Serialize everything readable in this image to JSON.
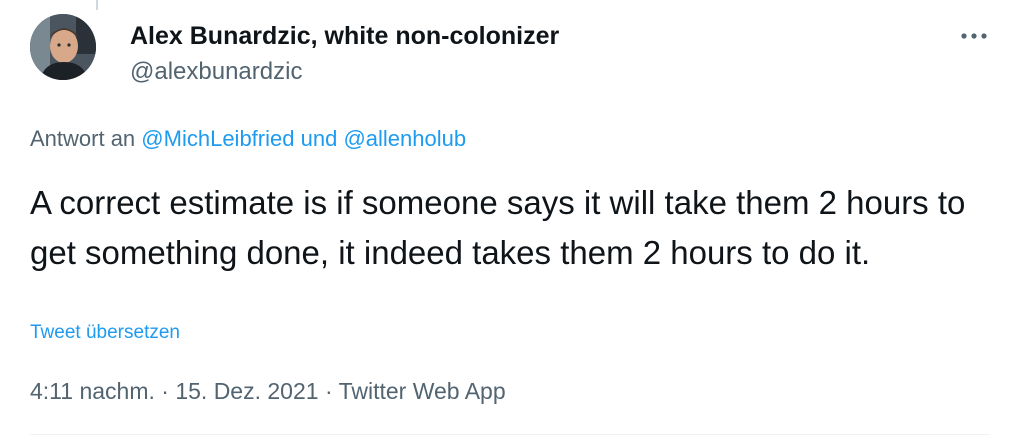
{
  "author": {
    "name": "Alex Bunardzic, white non-colonizer",
    "handle": "@alexbunardzic"
  },
  "reply": {
    "prefix": "Antwort an",
    "mention_1": "@MichLeibfried",
    "conjunction": "und",
    "mention_2": "@allenholub"
  },
  "tweet": {
    "text": "A correct estimate is if someone says it will take them 2 hours to get something done, it indeed takes them 2 hours to do it.",
    "translate_label": "Tweet übersetzen"
  },
  "meta": {
    "time": "4:11 nachm.",
    "separator": "·",
    "date": "15. Dez. 2021",
    "source": "Twitter Web App"
  },
  "icons": {
    "more": "more-horizontal-icon"
  },
  "colors": {
    "link": "#1d9bf0",
    "secondary_text": "#536471",
    "primary_text": "#0f1419"
  }
}
